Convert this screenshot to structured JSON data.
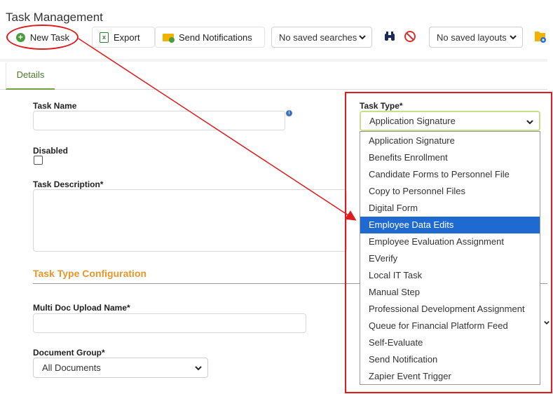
{
  "page": {
    "title": "Task Management"
  },
  "toolbar": {
    "new_task": "New Task",
    "export": "Export",
    "send_notifications": "Send Notifications",
    "saved_searches": "No saved searches",
    "saved_layouts": "No saved layouts"
  },
  "tabs": {
    "details": "Details"
  },
  "form": {
    "task_name_label": "Task Name",
    "info_icon": "i",
    "disabled_label": "Disabled",
    "task_description_label": "Task Description*",
    "task_type_label": "Task Type*",
    "task_type_value": "Application Signature",
    "section_title": "Task Type Configuration",
    "multi_doc_label": "Multi Doc Upload Name*",
    "document_group_label": "Document Group*",
    "document_group_value": "All Documents"
  },
  "dropdown": {
    "options": [
      "Application Signature",
      "Benefits Enrollment",
      "Candidate Forms to Personnel File",
      "Copy to Personnel Files",
      "Digital Form",
      "Employee Data Edits",
      "Employee Evaluation Assignment",
      "EVerify",
      "Local IT Task",
      "Manual Step",
      "Professional Development Assignment",
      "Queue for Financial Platform Feed",
      "Self-Evaluate",
      "Send Notification",
      "Zapier Event Trigger"
    ],
    "highlighted": "Employee Data Edits"
  },
  "colors": {
    "accent_green": "#4a9d3f",
    "section_orange": "#e8962a",
    "highlight_blue": "#1f6ad1",
    "annotation_red": "#e01b1b"
  },
  "icons": [
    "plus-circle-icon",
    "excel-icon",
    "envelope-icon",
    "binoculars-icon",
    "no-entry-icon",
    "folder-gear-icon",
    "chevron-down-icon",
    "info-icon"
  ]
}
